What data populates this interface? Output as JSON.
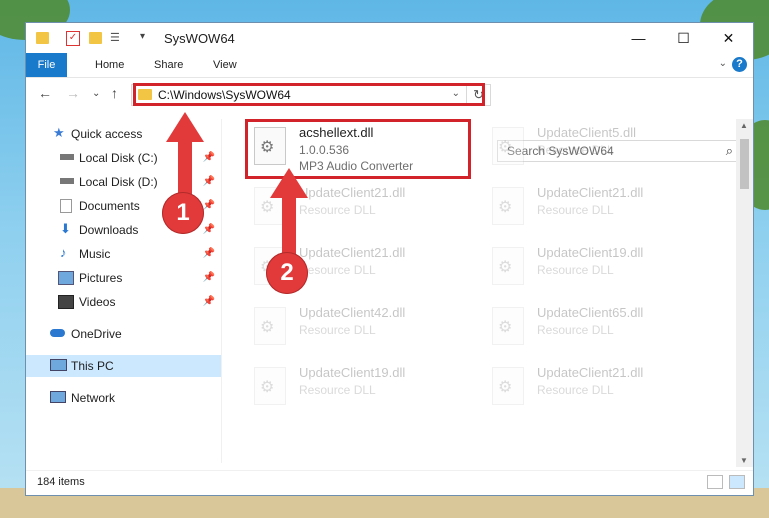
{
  "window": {
    "title": "SysWOW64",
    "buttons": {
      "minimize": "—",
      "maximize": "☐",
      "close": "✕"
    }
  },
  "ribbon": {
    "tabs": [
      "File",
      "Home",
      "Share",
      "View"
    ],
    "help": "?"
  },
  "navigation": {
    "address": "C:\\Windows\\SysWOW64",
    "search_placeholder": "Search SysWOW64"
  },
  "sidebar": {
    "quick_access": "Quick access",
    "items": [
      {
        "label": "Local Disk (C:)"
      },
      {
        "label": "Local Disk (D:)"
      },
      {
        "label": "Documents"
      },
      {
        "label": "Downloads"
      },
      {
        "label": "Music"
      },
      {
        "label": "Pictures"
      },
      {
        "label": "Videos"
      }
    ],
    "onedrive": "OneDrive",
    "this_pc": "This PC",
    "network": "Network"
  },
  "files": [
    {
      "name": "acshellext.dll",
      "version": "1.0.0.536",
      "description": "MP3 Audio Converter"
    },
    {
      "name": "UpdateClient5.dll",
      "description": "Resource DLL"
    },
    {
      "name": "UpdateClient21.dll",
      "description": "Resource DLL"
    },
    {
      "name": "UpdateClient21.dll",
      "description": "Resource DLL"
    },
    {
      "name": "UpdateClient21.dll",
      "description": "Resource DLL"
    },
    {
      "name": "UpdateClient19.dll",
      "description": "Resource DLL"
    },
    {
      "name": "UpdateClient42.dll",
      "description": "Resource DLL"
    },
    {
      "name": "UpdateClient65.dll",
      "description": "Resource DLL"
    },
    {
      "name": "UpdateClient19.dll",
      "description": "Resource DLL"
    },
    {
      "name": "UpdateClient21.dll",
      "description": "Resource DLL"
    }
  ],
  "status": {
    "items": "184 items"
  },
  "annotations": {
    "one": "1",
    "two": "2"
  },
  "colors": {
    "accent": "#1979ca",
    "highlight": "#d2232a",
    "selected": "#cce8ff"
  }
}
